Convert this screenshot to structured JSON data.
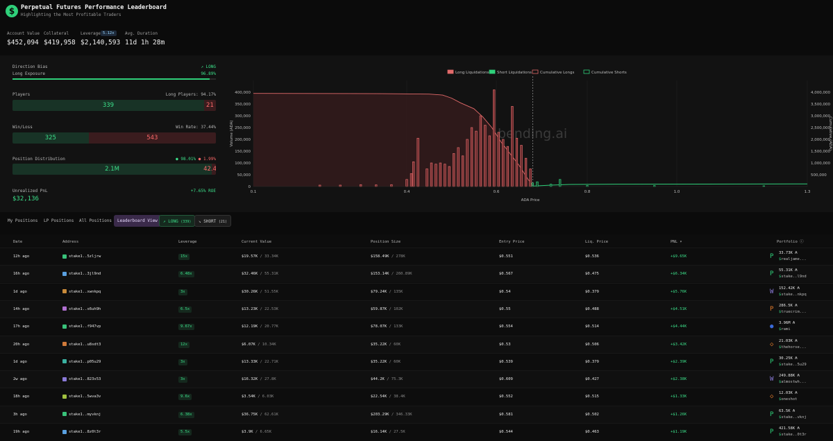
{
  "header": {
    "title": "Perpetual Futures Performance Leaderboard",
    "subtitle": "Highlighting the Most Profitable Traders",
    "logo_glyph": "$"
  },
  "stats": {
    "account_value_label": "Account Value",
    "account_value": "$452,094",
    "collateral_label": "Collateral",
    "collateral": "$419,958",
    "leverage_label": "Leverage",
    "leverage_badge": "5.12x",
    "leverage_value": "$2,140,593",
    "avg_duration_label": "Avg. Duration",
    "avg_duration": "11d 1h 28m"
  },
  "panel": {
    "direction_bias_label": "Direction Bias",
    "direction_bias_value": "LONG",
    "long_exposure_label": "Long Exposure",
    "long_exposure_value": "96.89%",
    "long_exposure_fraction": 0.9689,
    "players_label": "Players",
    "long_players_label": "Long Players: 94.17%",
    "players_long": "339",
    "players_short": "21",
    "players_long_fraction": 0.9417,
    "winloss_label": "Win/Loss",
    "win_rate_label": "Win Rate: 37.44%",
    "wins": "325",
    "losses": "543",
    "win_fraction": 0.3744,
    "position_dist_label": "Position Distribution",
    "position_dist_long_pct": "98.01%",
    "position_dist_short_pct": "1.99%",
    "position_long": "2.1M",
    "position_short": "42.49K",
    "position_long_fraction": 0.9801,
    "unrealized_label": "Unrealized PnL",
    "unrealized_roe": "+7.65% ROE",
    "unrealized_value": "$32,136"
  },
  "chart_data": {
    "type": "bar",
    "watermark": "bending.ai",
    "xlabel": "ADA Price",
    "ylabel": "Volume (ADA)",
    "y2label": "Cumulative (ADA)",
    "x_ticks": [
      "0.1",
      "0.4",
      "0.6",
      "0.8",
      "1.0",
      "1.3"
    ],
    "y_ticks": [
      "0",
      "50,000",
      "100,000",
      "150,000",
      "200,000",
      "250,000",
      "300,000",
      "350,000",
      "400,000"
    ],
    "y2_ticks": [
      "500,000",
      "1,000,000",
      "1,500,000",
      "2,000,000",
      "2,500,000",
      "3,000,000",
      "3,500,000",
      "4,000,000"
    ],
    "ylim": [
      0,
      450000
    ],
    "y2lim": [
      0,
      4500000
    ],
    "current_price": 0.68,
    "legend": [
      "Long Liquidations",
      "Short Liquidations",
      "Cumulative Longs",
      "Cumulative Shorts"
    ],
    "colors": {
      "long": "#e26a6a",
      "short": "#2fd07a",
      "cum_long": "#e26a6a",
      "cum_short": "#2fd07a"
    },
    "long_liquidations": [
      {
        "x": 0.4,
        "y": 30000
      },
      {
        "x": 0.41,
        "y": 55000
      },
      {
        "x": 0.415,
        "y": 105000
      },
      {
        "x": 0.425,
        "y": 205000
      },
      {
        "x": 0.445,
        "y": 75000
      },
      {
        "x": 0.455,
        "y": 100000
      },
      {
        "x": 0.465,
        "y": 95000
      },
      {
        "x": 0.475,
        "y": 100000
      },
      {
        "x": 0.485,
        "y": 95000
      },
      {
        "x": 0.495,
        "y": 85000
      },
      {
        "x": 0.505,
        "y": 140000
      },
      {
        "x": 0.515,
        "y": 165000
      },
      {
        "x": 0.525,
        "y": 130000
      },
      {
        "x": 0.535,
        "y": 200000
      },
      {
        "x": 0.545,
        "y": 250000
      },
      {
        "x": 0.555,
        "y": 235000
      },
      {
        "x": 0.565,
        "y": 300000
      },
      {
        "x": 0.575,
        "y": 260000
      },
      {
        "x": 0.585,
        "y": 215000
      },
      {
        "x": 0.595,
        "y": 410000
      },
      {
        "x": 0.605,
        "y": 230000
      },
      {
        "x": 0.615,
        "y": 200000
      },
      {
        "x": 0.625,
        "y": 170000
      },
      {
        "x": 0.635,
        "y": 340000
      },
      {
        "x": 0.645,
        "y": 205000
      },
      {
        "x": 0.655,
        "y": 175000
      },
      {
        "x": 0.665,
        "y": 120000
      },
      {
        "x": 0.675,
        "y": 75000
      }
    ],
    "short_liquidations": [
      {
        "x": 0.68,
        "y": 15000
      },
      {
        "x": 0.69,
        "y": 20000
      },
      {
        "x": 0.72,
        "y": 10000
      },
      {
        "x": 0.74,
        "y": 30000
      },
      {
        "x": 0.8,
        "y": 4000
      },
      {
        "x": 0.95,
        "y": 4000
      },
      {
        "x": 1.2,
        "y": 3000
      }
    ],
    "small_long_bars": [
      {
        "x": 0.23,
        "y": 6000
      },
      {
        "x": 0.27,
        "y": 6000
      },
      {
        "x": 0.31,
        "y": 8000
      },
      {
        "x": 0.34,
        "y": 7000
      },
      {
        "x": 0.37,
        "y": 8000
      }
    ],
    "cumulative_longs": [
      {
        "x": 0.1,
        "y": 3950000
      },
      {
        "x": 0.35,
        "y": 3940000
      },
      {
        "x": 0.45,
        "y": 3920000
      },
      {
        "x": 0.48,
        "y": 3880000
      },
      {
        "x": 0.5,
        "y": 3750000
      },
      {
        "x": 0.52,
        "y": 3550000
      },
      {
        "x": 0.55,
        "y": 3300000
      },
      {
        "x": 0.57,
        "y": 2950000
      },
      {
        "x": 0.59,
        "y": 2500000
      },
      {
        "x": 0.61,
        "y": 1900000
      },
      {
        "x": 0.63,
        "y": 1400000
      },
      {
        "x": 0.65,
        "y": 900000
      },
      {
        "x": 0.66,
        "y": 600000
      },
      {
        "x": 0.67,
        "y": 300000
      },
      {
        "x": 0.68,
        "y": 50000
      }
    ],
    "cumulative_shorts": [
      {
        "x": 0.68,
        "y": 20000
      },
      {
        "x": 0.72,
        "y": 60000
      },
      {
        "x": 0.76,
        "y": 90000
      },
      {
        "x": 0.9,
        "y": 100000
      },
      {
        "x": 1.3,
        "y": 110000
      }
    ]
  },
  "tabs": {
    "my_positions": "My Positions",
    "lp_positions": "LP Positions",
    "all_positions": "All Positions",
    "leaderboard": "Leaderboard View",
    "long": "LONG",
    "long_count": "(339)",
    "short": "SHORT",
    "short_count": "(21)"
  },
  "table": {
    "headers": [
      "Date",
      "Address",
      "Leverage",
      "Current Value",
      "Position Size",
      "Entry Price",
      "Liq. Price",
      "PNL ▾",
      "Portfolio"
    ],
    "rows": [
      {
        "date": "12h ago",
        "address": "stake1..5zljrw",
        "icon_color": "#39c27a",
        "lev": "15x",
        "cv": "$19.57K",
        "cv2": "/ 33.34K",
        "ps": "$158.49K",
        "ps2": "/ 278K",
        "entry": "$0.551",
        "liq": "$0.536",
        "pnl": "+$9.65K",
        "pf_val": "33.73K",
        "pf_name": "realjame...",
        "pf_icon": "P",
        "pf_color": "#2fd07a"
      },
      {
        "date": "16h ago",
        "address": "stake1..3jl9nd",
        "icon_color": "#5aa0e0",
        "lev": "6.48x",
        "cv": "$32.46K",
        "cv2": "/ 55.31K",
        "ps": "$153.14K",
        "ps2": "/ 260.89K",
        "entry": "$0.567",
        "liq": "$0.475",
        "pnl": "+$6.34K",
        "pf_val": "55.31K",
        "pf_name": "stake..l9nd",
        "pf_icon": "P",
        "pf_color": "#2fd07a"
      },
      {
        "date": "1d ago",
        "address": "stake1..xwnkpq",
        "icon_color": "#c88a3a",
        "lev": "3x",
        "cv": "$30.26K",
        "cv2": "/ 51.55K",
        "ps": "$79.24K",
        "ps2": "/ 135K",
        "entry": "$0.54",
        "liq": "$0.379",
        "pnl": "+$5.76K",
        "pf_val": "152.42K",
        "pf_name": "stake..nkpq",
        "pf_icon": "W",
        "pf_color": "#8a7ad8"
      },
      {
        "date": "14h ago",
        "address": "stake1..s6uh9h",
        "icon_color": "#b070d0",
        "lev": "6.5x",
        "cv": "$13.23K",
        "cv2": "/ 22.53K",
        "ps": "$59.87K",
        "ps2": "/ 102K",
        "entry": "$0.55",
        "liq": "$0.488",
        "pnl": "+$4.51K",
        "pf_val": "286.5K",
        "pf_name": "truecrim...",
        "pf_icon": "P",
        "pf_color": "#e07a2a"
      },
      {
        "date": "17h ago",
        "address": "stake1..f947vp",
        "icon_color": "#39c27a",
        "lev": "9.67x",
        "cv": "$12.19K",
        "cv2": "/ 20.77K",
        "ps": "$78.07K",
        "ps2": "/ 133K",
        "entry": "$0.554",
        "liq": "$0.514",
        "pnl": "+$4.44K",
        "pf_val": "3.96M",
        "pf_name": "rami",
        "pf_icon": "●",
        "pf_color": "#3a6ad8"
      },
      {
        "date": "20h ago",
        "address": "stake1..u8sdt3",
        "icon_color": "#d07a3a",
        "lev": "12x",
        "cv": "$6.07K",
        "cv2": "/ 10.34K",
        "ps": "$35.22K",
        "ps2": "/ 60K",
        "entry": "$0.53",
        "liq": "$0.506",
        "pnl": "+$3.42K",
        "pf_val": "21.03K",
        "pf_name": "thehorse...",
        "pf_icon": "◇",
        "pf_color": "#e07a2a"
      },
      {
        "date": "1d ago",
        "address": "stake1..p05u29",
        "icon_color": "#3ab0a0",
        "lev": "3x",
        "cv": "$13.33K",
        "cv2": "/ 22.71K",
        "ps": "$35.22K",
        "ps2": "/ 60K",
        "entry": "$0.539",
        "liq": "$0.379",
        "pnl": "+$2.39K",
        "pf_val": "30.25K",
        "pf_name": "stake..5u29",
        "pf_icon": "P",
        "pf_color": "#2fd07a"
      },
      {
        "date": "2w ago",
        "address": "stake1..823s53",
        "icon_color": "#8a7ad8",
        "lev": "3x",
        "cv": "$16.32K",
        "cv2": "/ 27.8K",
        "ps": "$44.2K",
        "ps2": "/ 75.3K",
        "entry": "$0.609",
        "liq": "$0.427",
        "pnl": "+$2.38K",
        "pf_val": "249.88K",
        "pf_name": "almostwh...",
        "pf_icon": "W",
        "pf_color": "#8a7ad8"
      },
      {
        "date": "18h ago",
        "address": "stake1..5wva3v",
        "icon_color": "#a0c040",
        "lev": "9.6x",
        "cv": "$3.54K",
        "cv2": "/ 6.03K",
        "ps": "$22.54K",
        "ps2": "/ 38.4K",
        "entry": "$0.552",
        "liq": "$0.515",
        "pnl": "+$1.33K",
        "pf_val": "12.03K",
        "pf_name": "oneshot",
        "pf_icon": "◇",
        "pf_color": "#e07a2a"
      },
      {
        "date": "3h ago",
        "address": "stake1..myvknj",
        "icon_color": "#39c27a",
        "lev": "6.38x",
        "cv": "$36.75K",
        "cv2": "/ 62.61K",
        "ps": "$203.29K",
        "ps2": "/ 346.33K",
        "entry": "$0.581",
        "liq": "$0.502",
        "pnl": "+$1.26K",
        "pf_val": "63.5K",
        "pf_name": "stake..vknj",
        "pf_icon": "P",
        "pf_color": "#2fd07a"
      },
      {
        "date": "19h ago",
        "address": "stake1..8z0t3r",
        "icon_color": "#5aa0e0",
        "lev": "5.5x",
        "cv": "$3.9K",
        "cv2": "/ 6.65K",
        "ps": "$16.14K",
        "ps2": "/ 27.5K",
        "entry": "$0.544",
        "liq": "$0.463",
        "pnl": "+$1.19K",
        "pf_val": "421.58K",
        "pf_name": "stake..0t3r",
        "pf_icon": "P",
        "pf_color": "#2fd07a"
      }
    ]
  }
}
